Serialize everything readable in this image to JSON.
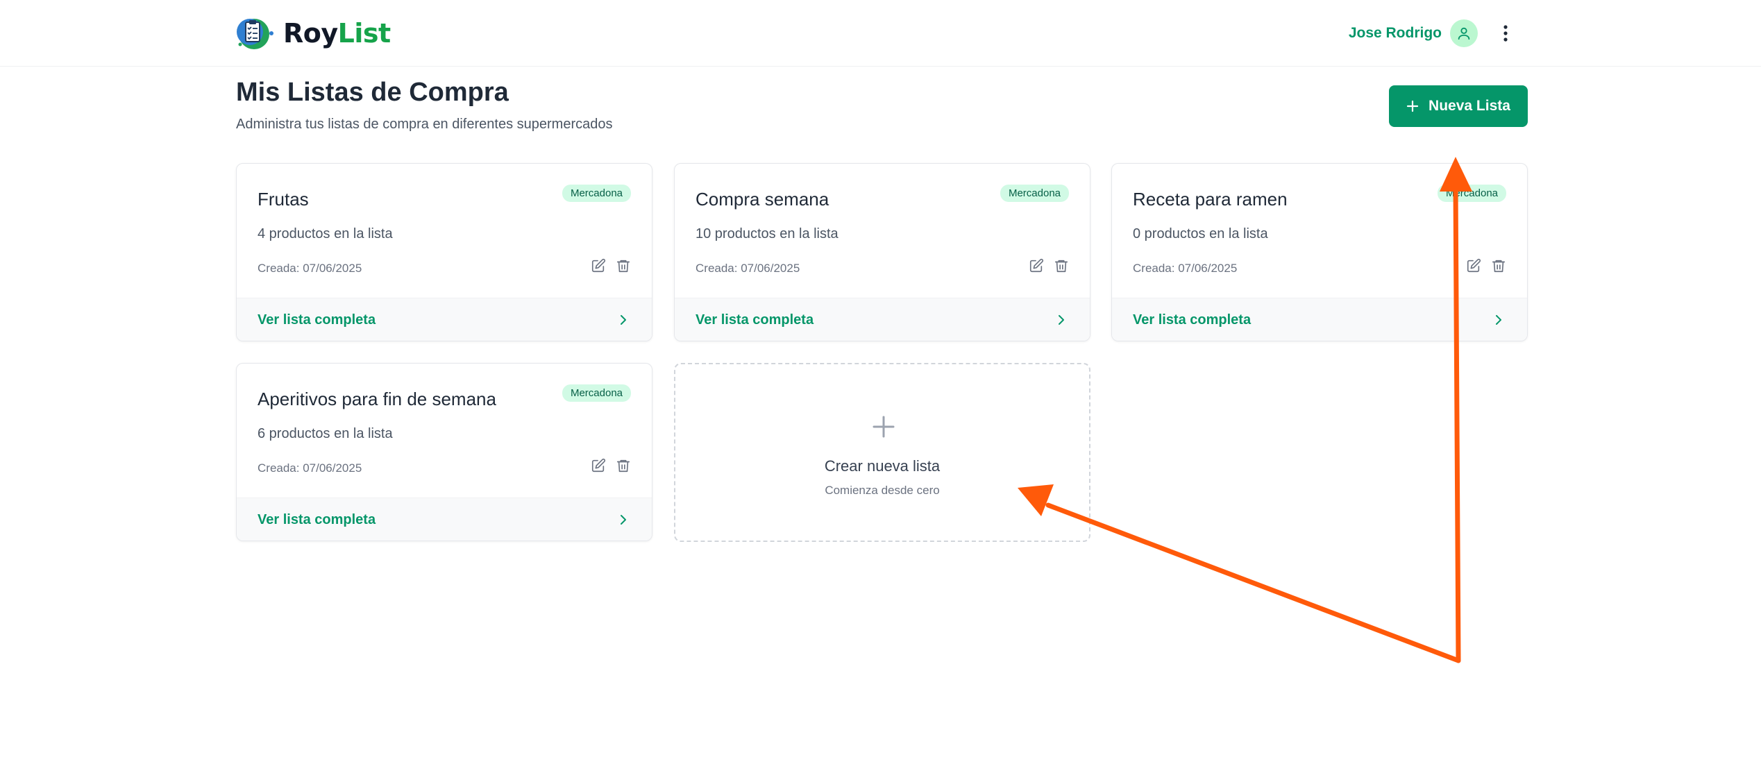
{
  "app": {
    "name_part1": "Roy",
    "name_part2": "List",
    "logo_icon": "clipboard-checklist-icon"
  },
  "header": {
    "user_name": "Jose Rodrigo",
    "avatar_icon": "user-icon",
    "menu_icon": "more-vertical-icon"
  },
  "page": {
    "title": "Mis Listas de Compra",
    "subtitle": "Administra tus listas de compra en diferentes supermercados",
    "new_button_label": "Nueva Lista"
  },
  "lists": [
    {
      "title": "Frutas",
      "store": "Mercadona",
      "count_text": "4 productos en la lista",
      "created": "Creada: 07/06/2025",
      "link_label": "Ver lista completa"
    },
    {
      "title": "Compra semana",
      "store": "Mercadona",
      "count_text": "10 productos en la lista",
      "created": "Creada: 07/06/2025",
      "link_label": "Ver lista completa"
    },
    {
      "title": "Receta para ramen",
      "store": "Mercadona",
      "count_text": "0 productos en la lista",
      "created": "Creada: 07/06/2025",
      "link_label": "Ver lista completa"
    },
    {
      "title": "Aperitivos para fin de semana",
      "store": "Mercadona",
      "count_text": "6 productos en la lista",
      "created": "Creada: 07/06/2025",
      "link_label": "Ver lista completa"
    }
  ],
  "create_card": {
    "title": "Crear nueva lista",
    "subtitle": "Comienza desde cero"
  },
  "colors": {
    "brand_green": "#059669",
    "badge_bg": "#d1fae5",
    "annotation_arrow": "#ff5a0a"
  }
}
